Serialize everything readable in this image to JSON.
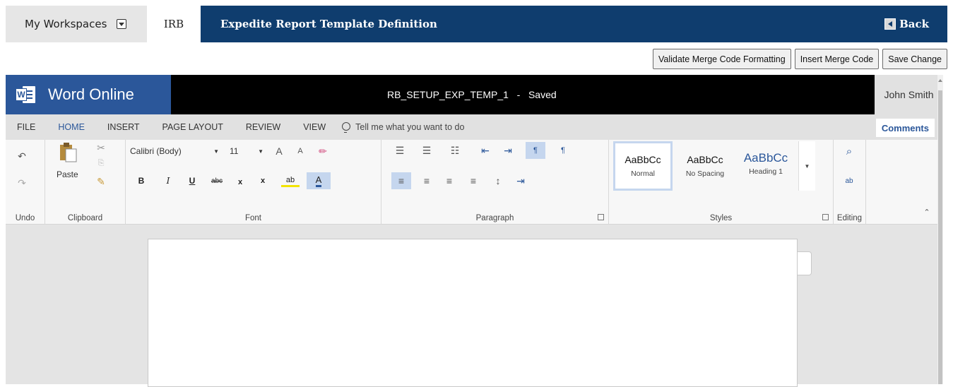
{
  "topbar": {
    "workspaces_label": "My Workspaces",
    "module_label": "IRB",
    "page_title": "Expedite Report Template Definition",
    "back_label": "Back"
  },
  "actions": {
    "validate_label": "Validate Merge Code Formatting",
    "insert_label": "Insert Merge Code",
    "save_label": "Save Change"
  },
  "word": {
    "app_name": "Word Online",
    "doc_title": "RB_SETUP_EXP_TEMP_1   -   Saved",
    "user_name": "John Smith",
    "accent_color": "#2b579a",
    "tabs": [
      "FILE",
      "HOME",
      "INSERT",
      "PAGE LAYOUT",
      "REVIEW",
      "VIEW"
    ],
    "tell_me": "Tell me what you want to do",
    "comments": "Comments",
    "ribbon": {
      "paste": "Paste",
      "font_name": "Calibri (Body)",
      "font_size": "11",
      "groups": [
        "Undo",
        "Clipboard",
        "Font",
        "Paragraph",
        "Styles",
        "Editing"
      ],
      "styles": [
        {
          "sample": "AaBbCc",
          "name": "Normal"
        },
        {
          "sample": "AaBbCc",
          "name": "No Spacing"
        },
        {
          "sample": "AaBbCc",
          "name": "Heading 1"
        }
      ],
      "bold": "B",
      "italic": "I",
      "underline": "U",
      "strike": "abc",
      "subscript": "x",
      "superscript": "x",
      "grow_font": "A",
      "shrink_font": "A",
      "font_color": "A",
      "replace": "ab"
    }
  }
}
